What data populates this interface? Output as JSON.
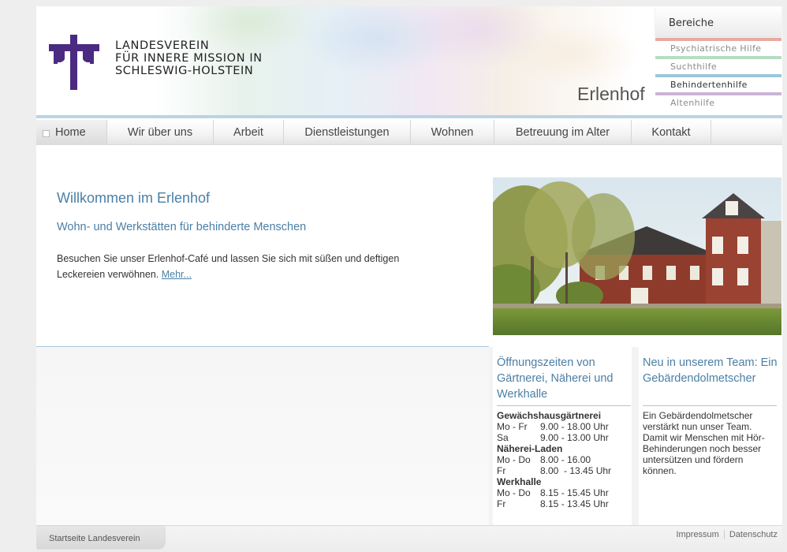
{
  "header": {
    "logo_lines": [
      "LANDESVEREIN",
      "FÜR INNERE MISSION IN",
      "SCHLESWIG-HOLSTEIN"
    ],
    "site_name": "Erlenhof"
  },
  "bereiche": {
    "title": "Bereiche",
    "items": [
      {
        "label": "Psychiatrische Hilfe",
        "color": "#e8a9a0",
        "text_color": "#8c8c8c"
      },
      {
        "label": "Suchthilfe",
        "color": "#b8dcc4",
        "text_color": "#8c8c8c"
      },
      {
        "label": "Behindertenhilfe",
        "color": "#9cc6dc",
        "text_color": "#333333"
      },
      {
        "label": "Altenhilfe",
        "color": "#cdb3d6",
        "text_color": "#8c8c8c"
      }
    ]
  },
  "nav": {
    "items": [
      "Home",
      "Wir über uns",
      "Arbeit",
      "Dienstleistungen",
      "Wohnen",
      "Betreuung im Alter",
      "Kontakt"
    ]
  },
  "main": {
    "heading": "Willkommen im Erlenhof",
    "subheading": "Wohn- und Werkstätten für behinderte Menschen",
    "paragraph_line1": "Besuchen Sie unser Erlenhof-Café und lassen Sie sich mit süßen und deftigen",
    "paragraph_line2": "Leckereien verwöhnen.",
    "more_link": "Mehr..."
  },
  "hours_box": {
    "heading": "Öffnungszeiten von Gärtnerei, Näherei und Werkhalle",
    "sections": [
      {
        "title": "Gewächshausgärtnerei",
        "rows": [
          [
            "Mo - Fr",
            "9.00 - 18.00 Uhr"
          ],
          [
            "Sa",
            "9.00 - 13.00 Uhr"
          ]
        ]
      },
      {
        "title": "Näherei-Laden",
        "rows": [
          [
            "Mo - Do",
            "8.00 - 16.00"
          ],
          [
            "Fr",
            "8.00  - 13.45 Uhr"
          ]
        ]
      },
      {
        "title": "Werkhalle",
        "rows": [
          [
            "Mo - Do",
            "8.15 - 15.45 Uhr"
          ],
          [
            "Fr",
            "8.15 - 13.45 Uhr"
          ]
        ]
      }
    ]
  },
  "team_box": {
    "heading": "Neu in unserem Team: Ein Gebärdendolmetscher",
    "text": "Ein Gebärdendolmetscher verstärkt nun unser Team. Damit wir Menschen mit Hör-Behinderungen noch besser untersützen und fördern können."
  },
  "footer": {
    "home_link": "Startseite Landesverein",
    "impressum": "Impressum",
    "datenschutz": "Datenschutz"
  },
  "colors": {
    "accent": "#4a7fa6",
    "rule": "#b9d4e4",
    "logo": "#4b2a82"
  }
}
